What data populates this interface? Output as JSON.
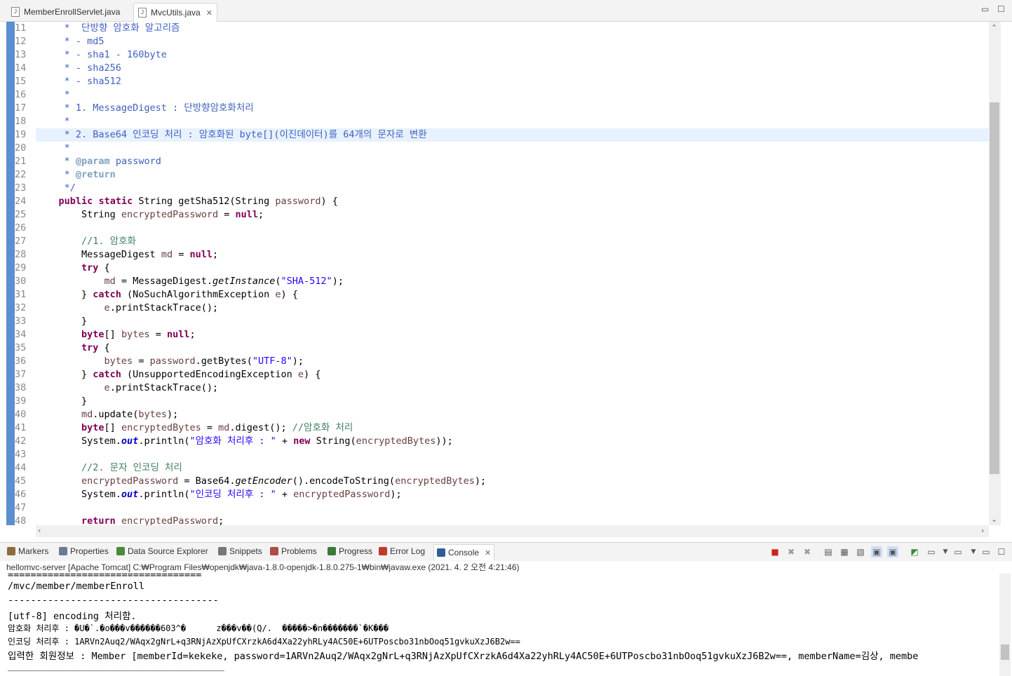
{
  "editor_tabs": [
    {
      "label": "MemberEnrollServlet.java",
      "active": false
    },
    {
      "label": "MvcUtils.java",
      "active": true
    }
  ],
  "editor": {
    "highlighted_line": 19,
    "lines": [
      {
        "n": "11",
        "tokens": [
          [
            "c",
            "     *  단방향 암호화 알고리즘"
          ]
        ]
      },
      {
        "n": "12",
        "tokens": [
          [
            "c",
            "     * - md5"
          ]
        ]
      },
      {
        "n": "13",
        "tokens": [
          [
            "c",
            "     * - sha1 - 160byte"
          ]
        ]
      },
      {
        "n": "14",
        "tokens": [
          [
            "c",
            "     * - sha256"
          ]
        ]
      },
      {
        "n": "15",
        "tokens": [
          [
            "c",
            "     * - sha512"
          ]
        ]
      },
      {
        "n": "16",
        "tokens": [
          [
            "c",
            "     *"
          ]
        ]
      },
      {
        "n": "17",
        "tokens": [
          [
            "c",
            "     * 1. MessageDigest : 단방향암호화처리"
          ]
        ]
      },
      {
        "n": "18",
        "tokens": [
          [
            "c",
            "     *"
          ]
        ]
      },
      {
        "n": "19",
        "tokens": [
          [
            "c",
            "     * 2. Base64 인코딩 처리 : 암호화된 byte[](이진데이터)를 64개의 문자로 변환"
          ]
        ]
      },
      {
        "n": "20",
        "tokens": [
          [
            "c",
            "     *"
          ]
        ]
      },
      {
        "n": "21",
        "tokens": [
          [
            "c",
            "     * "
          ],
          [
            "tg",
            "@param"
          ],
          [
            "c",
            " password"
          ]
        ]
      },
      {
        "n": "22",
        "tokens": [
          [
            "c",
            "     * "
          ],
          [
            "tg",
            "@return"
          ]
        ]
      },
      {
        "n": "23",
        "tokens": [
          [
            "c",
            "     */"
          ]
        ]
      },
      {
        "n": "24",
        "tokens": [
          [
            "",
            "    "
          ],
          [
            "k",
            "public"
          ],
          [
            "",
            " "
          ],
          [
            "k",
            "static"
          ],
          [
            "",
            " String getSha512(String "
          ],
          [
            "v",
            "password"
          ],
          [
            "",
            ") {"
          ]
        ]
      },
      {
        "n": "25",
        "tokens": [
          [
            "",
            "        String "
          ],
          [
            "v",
            "encryptedPassword"
          ],
          [
            "",
            " = "
          ],
          [
            "k",
            "null"
          ],
          [
            "",
            ";"
          ]
        ]
      },
      {
        "n": "26",
        "tokens": [
          [
            "",
            ""
          ]
        ]
      },
      {
        "n": "27",
        "tokens": [
          [
            "cm",
            "        //1. 암호화"
          ]
        ]
      },
      {
        "n": "28",
        "tokens": [
          [
            "",
            "        MessageDigest "
          ],
          [
            "v",
            "md"
          ],
          [
            "",
            " = "
          ],
          [
            "k",
            "null"
          ],
          [
            "",
            ";"
          ]
        ]
      },
      {
        "n": "29",
        "tokens": [
          [
            "",
            "        "
          ],
          [
            "k",
            "try"
          ],
          [
            "",
            " {"
          ]
        ]
      },
      {
        "n": "30",
        "tokens": [
          [
            "",
            "            "
          ],
          [
            "v",
            "md"
          ],
          [
            "",
            " = MessageDigest."
          ],
          [
            "it",
            "getInstance"
          ],
          [
            "",
            "("
          ],
          [
            "s",
            "\"SHA-512\""
          ],
          [
            "",
            ");"
          ]
        ]
      },
      {
        "n": "31",
        "tokens": [
          [
            "",
            "        } "
          ],
          [
            "k",
            "catch"
          ],
          [
            "",
            " (NoSuchAlgorithmException "
          ],
          [
            "v",
            "e"
          ],
          [
            "",
            ") {"
          ]
        ]
      },
      {
        "n": "32",
        "tokens": [
          [
            "",
            "            "
          ],
          [
            "v",
            "e"
          ],
          [
            "",
            ".printStackTrace();"
          ]
        ]
      },
      {
        "n": "33",
        "tokens": [
          [
            "",
            "        }"
          ]
        ]
      },
      {
        "n": "34",
        "tokens": [
          [
            "",
            "        "
          ],
          [
            "k",
            "byte"
          ],
          [
            "",
            "[] "
          ],
          [
            "v",
            "bytes"
          ],
          [
            "",
            " = "
          ],
          [
            "k",
            "null"
          ],
          [
            "",
            ";"
          ]
        ]
      },
      {
        "n": "35",
        "tokens": [
          [
            "",
            "        "
          ],
          [
            "k",
            "try"
          ],
          [
            "",
            " {"
          ]
        ]
      },
      {
        "n": "36",
        "tokens": [
          [
            "",
            "            "
          ],
          [
            "v",
            "bytes"
          ],
          [
            "",
            " = "
          ],
          [
            "v",
            "password"
          ],
          [
            "",
            ".getBytes("
          ],
          [
            "s",
            "\"UTF-8\""
          ],
          [
            "",
            ");"
          ]
        ]
      },
      {
        "n": "37",
        "tokens": [
          [
            "",
            "        } "
          ],
          [
            "k",
            "catch"
          ],
          [
            "",
            " (UnsupportedEncodingException "
          ],
          [
            "v",
            "e"
          ],
          [
            "",
            ") {"
          ]
        ]
      },
      {
        "n": "38",
        "tokens": [
          [
            "",
            "            "
          ],
          [
            "v",
            "e"
          ],
          [
            "",
            ".printStackTrace();"
          ]
        ]
      },
      {
        "n": "39",
        "tokens": [
          [
            "",
            "        }"
          ]
        ]
      },
      {
        "n": "40",
        "tokens": [
          [
            "",
            "        "
          ],
          [
            "v",
            "md"
          ],
          [
            "",
            ".update("
          ],
          [
            "v",
            "bytes"
          ],
          [
            "",
            ");"
          ]
        ]
      },
      {
        "n": "41",
        "tokens": [
          [
            "",
            "        "
          ],
          [
            "k",
            "byte"
          ],
          [
            "",
            "[] "
          ],
          [
            "v",
            "encryptedBytes"
          ],
          [
            "",
            " = "
          ],
          [
            "v",
            "md"
          ],
          [
            "",
            ".digest(); "
          ],
          [
            "cm",
            "//암호화 처리"
          ]
        ]
      },
      {
        "n": "42",
        "tokens": [
          [
            "",
            "        System."
          ],
          [
            "f",
            "out"
          ],
          [
            "",
            ".println("
          ],
          [
            "s",
            "\"암호화 처리후 : \""
          ],
          [
            "",
            " + "
          ],
          [
            "k",
            "new"
          ],
          [
            "",
            " String("
          ],
          [
            "v",
            "encryptedBytes"
          ],
          [
            "",
            "));"
          ]
        ]
      },
      {
        "n": "43",
        "tokens": [
          [
            "",
            ""
          ]
        ]
      },
      {
        "n": "44",
        "tokens": [
          [
            "cm",
            "        //2. 문자 인코딩 처리"
          ]
        ]
      },
      {
        "n": "45",
        "tokens": [
          [
            "",
            "        "
          ],
          [
            "v",
            "encryptedPassword"
          ],
          [
            "",
            " = Base64."
          ],
          [
            "it",
            "getEncoder"
          ],
          [
            "",
            "().encodeToString("
          ],
          [
            "v",
            "encryptedBytes"
          ],
          [
            "",
            ");"
          ]
        ]
      },
      {
        "n": "46",
        "tokens": [
          [
            "",
            "        System."
          ],
          [
            "f",
            "out"
          ],
          [
            "",
            ".println("
          ],
          [
            "s",
            "\"인코딩 처리후 : \""
          ],
          [
            "",
            " + "
          ],
          [
            "v",
            "encryptedPassword"
          ],
          [
            "",
            ");"
          ]
        ]
      },
      {
        "n": "47",
        "tokens": [
          [
            "",
            ""
          ]
        ]
      },
      {
        "n": "48",
        "tokens": [
          [
            "",
            "        "
          ],
          [
            "k",
            "return"
          ],
          [
            "",
            " "
          ],
          [
            "v",
            "encryptedPassword"
          ],
          [
            "",
            ";"
          ]
        ]
      }
    ]
  },
  "panel_tabs": [
    {
      "label": "Markers",
      "icon": "markers-icon",
      "color": "#8a6d3b"
    },
    {
      "label": "Properties",
      "icon": "properties-icon",
      "color": "#6b7a99"
    },
    {
      "label": "Data Source Explorer",
      "icon": "data-source-icon",
      "color": "#4a8a3a"
    },
    {
      "label": "Snippets",
      "icon": "snippets-icon",
      "color": "#777777"
    },
    {
      "label": "Problems",
      "icon": "problems-icon",
      "color": "#b04a4a"
    },
    {
      "label": "Progress",
      "icon": "progress-icon",
      "color": "#3a7a3a"
    },
    {
      "label": "Error Log",
      "icon": "error-log-icon",
      "color": "#c0392b"
    },
    {
      "label": "Console",
      "icon": "console-icon",
      "color": "#2f5d9a",
      "active": true
    }
  ],
  "console": {
    "header": "hellomvc-server [Apache Tomcat] C:₩Program Files₩openjdk₩java-1.8.0-openjdk-1.8.0.275-1₩bin₩javaw.exe  (2021. 4. 2 오전 4:21:46)",
    "lines": [
      {
        "text": "==================================",
        "cls": ""
      },
      {
        "text": "/mvc/member/memberEnroll",
        "cls": ""
      },
      {
        "text": "-------------------------------------",
        "cls": ""
      },
      {
        "text": "[utf-8] encoding 처리함.",
        "cls": ""
      },
      {
        "text": "암호화 처리후 : �U�`.�o���v������603^�      z���v��(Q/.  �����>�n�������`�K���",
        "cls": "small"
      },
      {
        "text": "인코딩 처리후 : 1ARVn2Auq2/WAqx2gNrL+q3RNjAzXpUfCXrzkA6d4Xa22yhRLy4AC50E+6UTPoscbo31nbOoq51gvkuXzJ6B2w==",
        "cls": "small"
      },
      {
        "text": "입력한 회원정보 : Member [memberId=kekeke, password=1ARVn2Auq2/WAqx2gNrL+q3RNjAzXpUfCXrzkA6d4Xa22yhRLy4AC50E+6UTPoscbo31nbOoq51gvkuXzJ6B2w==, memberName=김상, membe",
        "cls": ""
      },
      {
        "text": "______________________________________",
        "cls": ""
      }
    ]
  }
}
